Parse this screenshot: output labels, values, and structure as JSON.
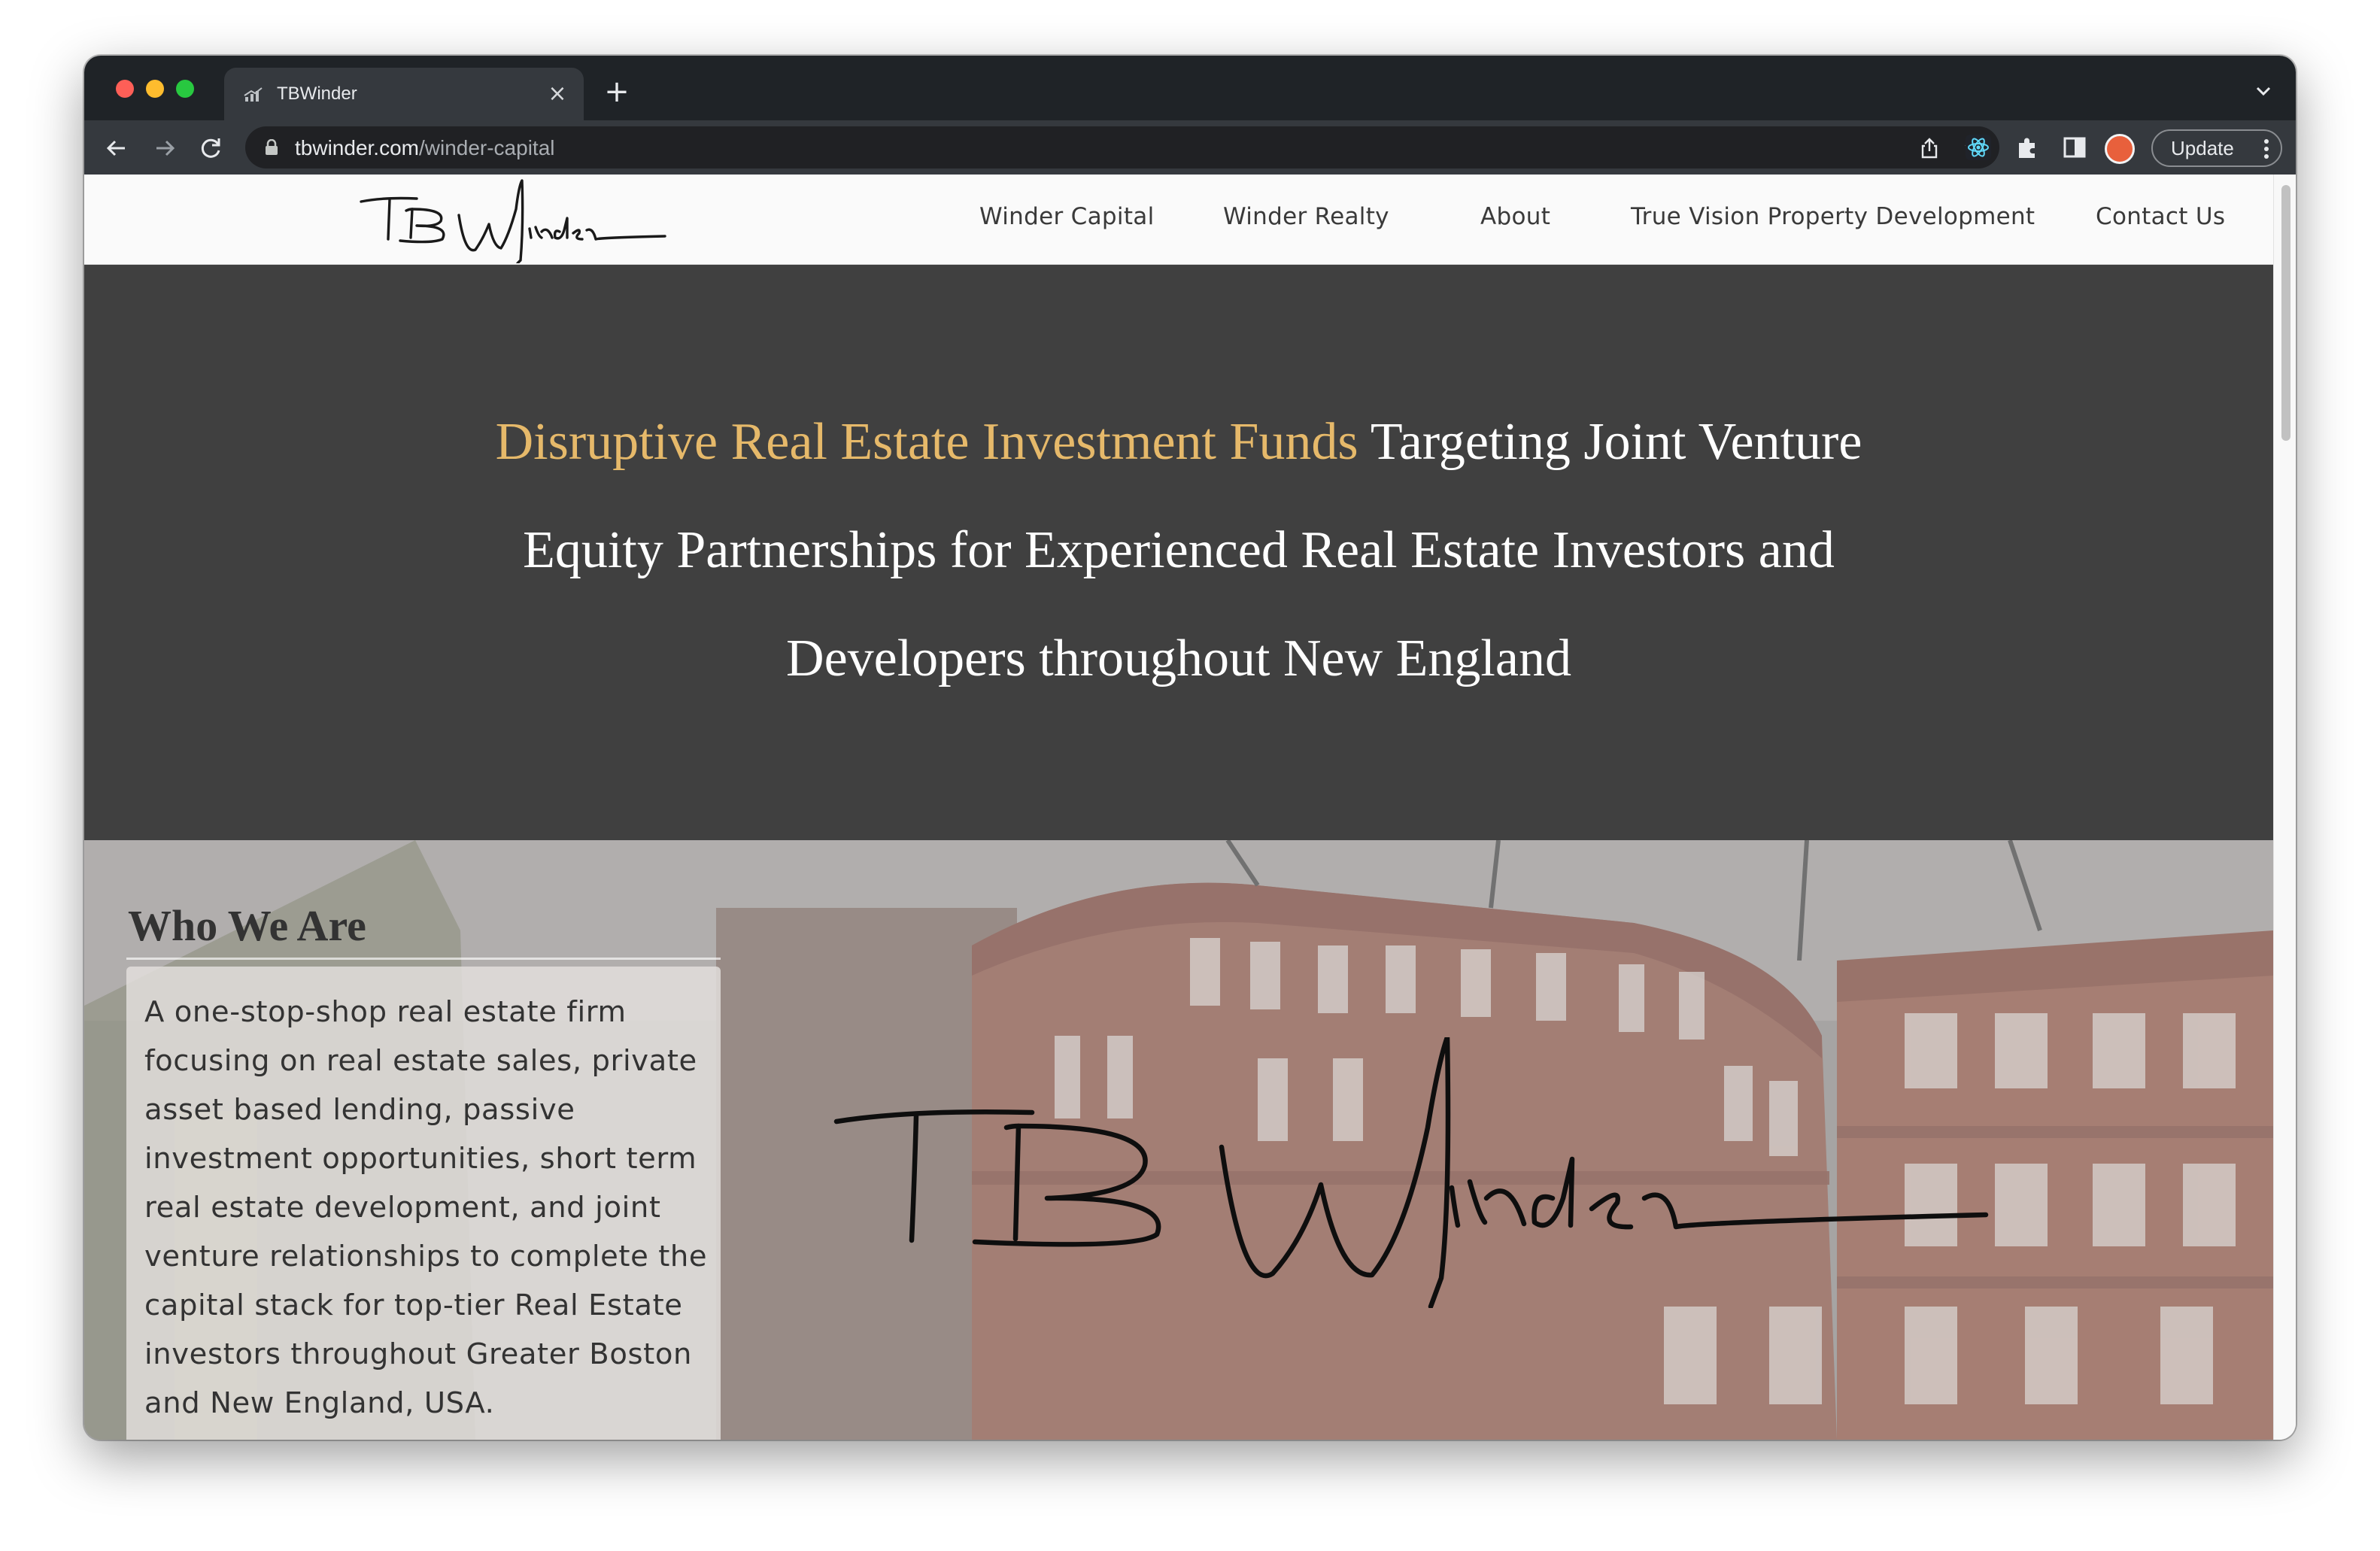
{
  "browser": {
    "tab_title": "TBWinder",
    "url_domain": "tbwinder.com",
    "url_path": "/winder-capital",
    "update_label": "Update",
    "icons": [
      "back-arrow-icon",
      "forward-arrow-icon",
      "reload-icon",
      "lock-icon",
      "share-icon",
      "star-icon",
      "react-devtools-icon",
      "extensions-icon",
      "sidebar-icon",
      "profile-avatar",
      "more-icon"
    ]
  },
  "site": {
    "nav": [
      "Winder Capital",
      "Winder Realty",
      "About",
      "True Vision Property Development",
      "Contact Us"
    ]
  },
  "hero": {
    "accent": "Disruptive Real Estate Investment Funds",
    "rest": " Targeting Joint Venture Equity Partnerships for Experienced Real Estate Investors and Developers throughout New England",
    "accent_color": "#e6b96a",
    "background": "#404040"
  },
  "who": {
    "title": "Who We Are",
    "body": "A one-stop-shop real estate firm focusing on real estate sales, private asset based lending, passive investment opportunities, short term real estate development, and joint venture relationships to complete the capital stack for top-tier Real Estate investors throughout Greater Boston and New England, USA."
  }
}
